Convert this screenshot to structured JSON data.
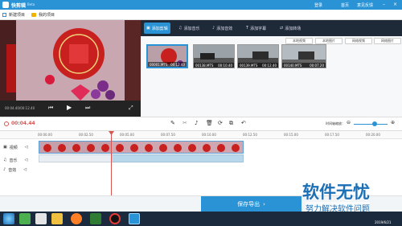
{
  "app": {
    "title": "快剪辑",
    "badge": "Beta"
  },
  "titlebar": {
    "links": [
      "登录",
      "首页",
      "意见反馈"
    ]
  },
  "toolbar": {
    "new_project": "新建项目",
    "my_projects": "我的项目"
  },
  "player": {
    "time": "00:04.40/00:12.40"
  },
  "tabs": [
    {
      "label": "添加剪辑",
      "icon": "film-icon"
    },
    {
      "label": "添加音乐",
      "icon": "music-icon"
    },
    {
      "label": "添加音效",
      "icon": "sound-icon"
    },
    {
      "label": "添加字幕",
      "icon": "text-icon"
    },
    {
      "label": "添加转场",
      "icon": "transition-icon"
    }
  ],
  "clip_tools": [
    "本地视频",
    "本地图片",
    "网络视频",
    "网络图片"
  ],
  "clips": [
    {
      "name": "00001.MTS",
      "duration": "00:12.40"
    },
    {
      "name": "00138.MTS",
      "duration": "00:10.40"
    },
    {
      "name": "00139.MTS",
      "duration": "00:12.40"
    },
    {
      "name": "00140.MTS",
      "duration": "00:07.20"
    }
  ],
  "editbar": {
    "current_time": "00:04.44",
    "zoom_label": "时间轴缩放："
  },
  "ruler": [
    "00:00.00",
    "00:02.50",
    "00:05.00",
    "00:07.50",
    "00:10.00",
    "00:12.50",
    "00:15.00",
    "00:17.50",
    "00:20.00"
  ],
  "tracks": [
    "视频",
    "音乐",
    "音效"
  ],
  "save_button": "保存导出",
  "taskbar": {
    "time": "2019/6/21"
  },
  "watermark": {
    "title": "软件无忧",
    "subtitle": "努力解决软件问题"
  },
  "colors": {
    "accent": "#2a93d5",
    "dark": "#1f2a38",
    "playhead": "#d9534f"
  }
}
